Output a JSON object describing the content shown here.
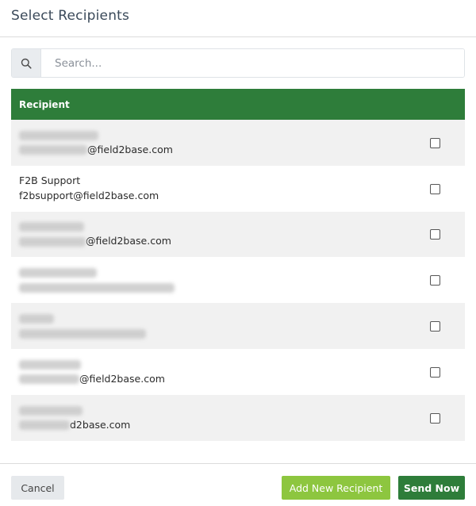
{
  "dialog": {
    "title": "Select Recipients"
  },
  "search": {
    "placeholder": "Search..."
  },
  "table": {
    "header": "Recipient",
    "rows": [
      {
        "name": "",
        "email_suffix": "@field2base.com",
        "checked": false
      },
      {
        "name": "F2B Support",
        "email_suffix": "f2bsupport@field2base.com",
        "checked": false
      },
      {
        "name": "",
        "email_suffix": "@field2base.com",
        "checked": false
      },
      {
        "name": "",
        "email_suffix": "",
        "checked": false
      },
      {
        "name": "",
        "email_suffix": "",
        "checked": false
      },
      {
        "name": "",
        "email_suffix": "@field2base.com",
        "checked": false
      },
      {
        "name": "",
        "email_suffix": "d2base.com",
        "checked": false
      }
    ]
  },
  "footer": {
    "cancel_label": "Cancel",
    "add_label": "Add New Recipient",
    "send_label": "Send Now"
  },
  "colors": {
    "primary_green": "#2e7d3a",
    "light_green": "#8dc63f",
    "stripe": "#f1f1f1"
  },
  "icons": {
    "search": "search-icon"
  }
}
